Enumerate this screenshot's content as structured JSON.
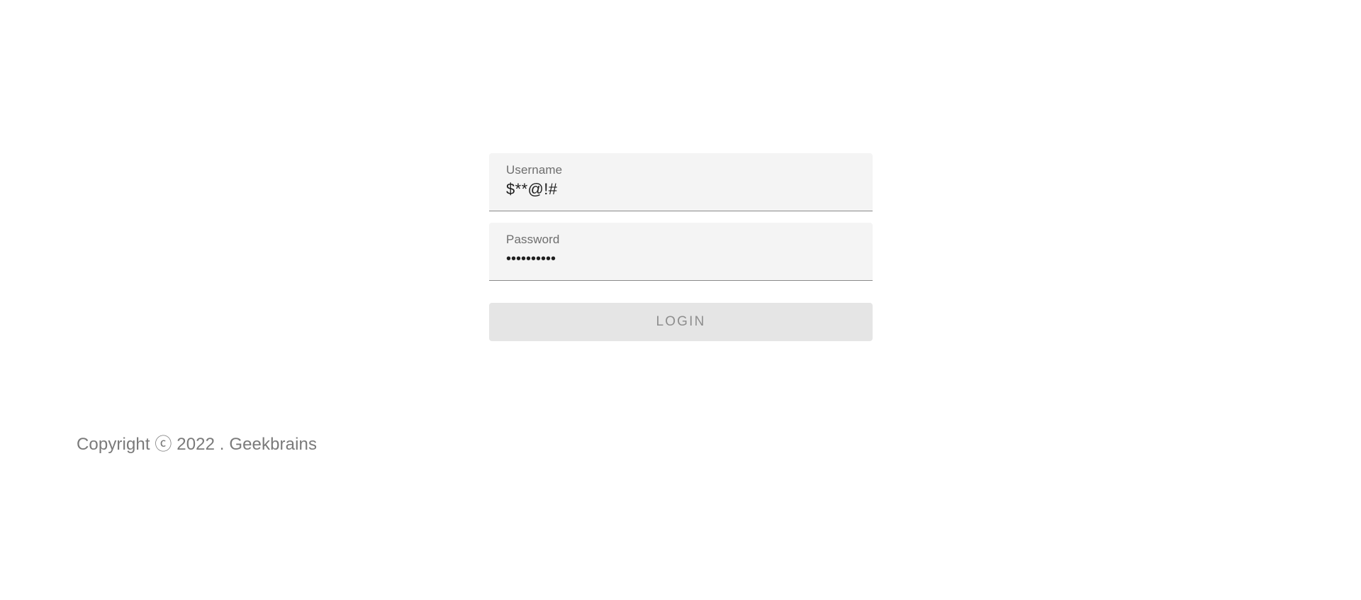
{
  "login_form": {
    "username": {
      "label": "Username",
      "value": "$**@!#"
    },
    "password": {
      "label": "Password",
      "value": "••••••••••"
    },
    "login_button_label": "LOGIN"
  },
  "footer": {
    "copyright_text": "Copyright ⓒ 2022 . Geekbrains"
  }
}
